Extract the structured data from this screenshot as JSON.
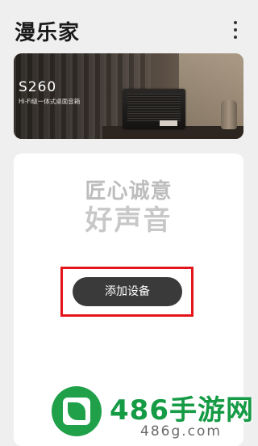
{
  "header": {
    "title": "漫乐家",
    "more_icon": "more-vertical-icon"
  },
  "banner": {
    "model": "S260",
    "subtitle": "Hi-Fi级一体式桌面音箱"
  },
  "card": {
    "slogan_line1": "匠心诚意",
    "slogan_line2": "好声音",
    "add_device_label": "添加设备",
    "highlight_color": "#e5141b"
  },
  "watermark": {
    "brand": "486手游网",
    "url": "486g.com"
  }
}
